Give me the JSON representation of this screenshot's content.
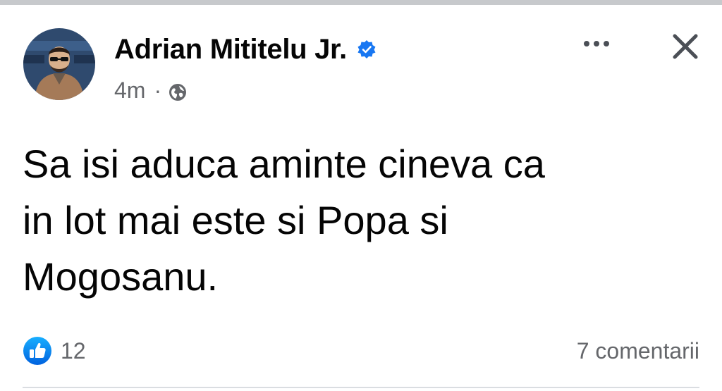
{
  "post": {
    "author_name": "Adrian Mititelu Jr.",
    "verified": true,
    "timestamp": "4m",
    "separator": "·",
    "audience_icon": "globe-icon",
    "text": "Sa isi aduca aminte cineva ca\nin lot mai este si Popa si\nMogosanu."
  },
  "actions": {
    "more_icon": "more-options-icon",
    "close_icon": "close-icon"
  },
  "footer": {
    "reaction_icon": "like-icon",
    "reaction_count": "12",
    "comments_label": "7 comentarii"
  },
  "colors": {
    "accent": "#1877f2",
    "secondary_text": "#65676b",
    "primary_text": "#050505",
    "divider": "#dadde1"
  }
}
